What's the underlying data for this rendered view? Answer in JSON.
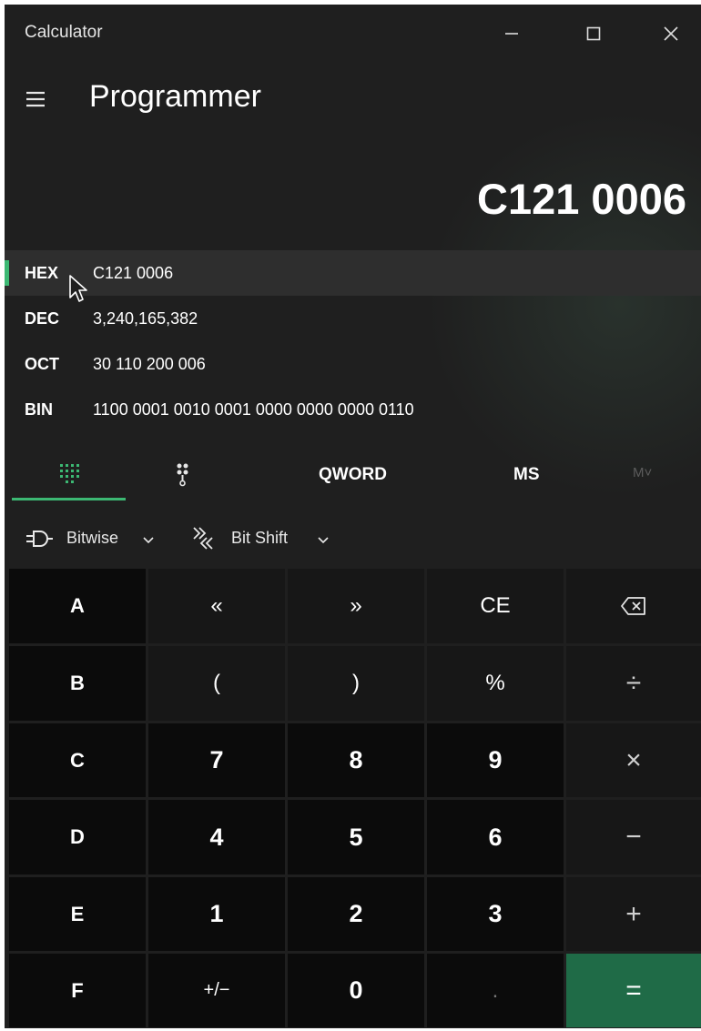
{
  "titlebar": {
    "app_title": "Calculator",
    "min_icon": "minimize-icon",
    "max_icon": "maximize-icon",
    "close_icon": "close-icon"
  },
  "header": {
    "menu_icon": "hamburger-menu-icon",
    "mode": "Programmer"
  },
  "display": {
    "value": "C121 0006"
  },
  "radix": [
    {
      "name": "HEX",
      "value": "C121 0006",
      "selected": true
    },
    {
      "name": "DEC",
      "value": "3,240,165,382",
      "selected": false
    },
    {
      "name": "OCT",
      "value": "30 110 200 006",
      "selected": false
    },
    {
      "name": "BIN",
      "value": "1100 0001 0010 0001 0000 0000 0000 0110",
      "selected": false
    }
  ],
  "nav": {
    "keypad_icon": "full-keypad-icon",
    "bit_toggle_icon": "bit-toggling-keypad-icon",
    "word_size": "QWORD",
    "memory_store": "MS",
    "memory_recall": "M˅"
  },
  "bitops": {
    "bitwise_label": "Bitwise",
    "bitwise_icon": "logic-gate-icon",
    "bitshift_label": "Bit Shift",
    "bitshift_icon": "bit-shift-icon"
  },
  "keys": {
    "r0": [
      "A",
      "«",
      "»",
      "CE",
      "⌫"
    ],
    "r1": [
      "B",
      "(",
      ")",
      "%",
      "÷"
    ],
    "r2": [
      "C",
      "7",
      "8",
      "9",
      "×"
    ],
    "r3": [
      "D",
      "4",
      "5",
      "6",
      "−"
    ],
    "r4": [
      "E",
      "1",
      "2",
      "3",
      "+"
    ],
    "r5": [
      "F",
      "+/−",
      "0",
      ".",
      "="
    ]
  },
  "colors": {
    "accent": "#3cb873",
    "equals": "#1f6b47",
    "background": "#1f1f1f"
  }
}
